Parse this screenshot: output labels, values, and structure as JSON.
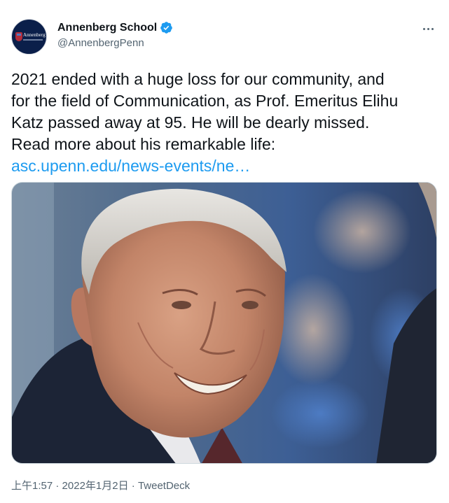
{
  "author": {
    "display_name": "Annenberg School",
    "handle": "@AnnenbergPenn",
    "avatar_text": "Annenberg",
    "verified_icon": "verified-badge-icon",
    "verified_color": "#1d9bf0"
  },
  "menu": {
    "icon": "more-horizontal-icon"
  },
  "tweet": {
    "lines": [
      "2021 ended with a huge loss for our community, and",
      "for the field of Communication, as Prof. Emeritus Elihu",
      "Katz passed away at 95. He will be dearly missed.",
      "Read more about his remarkable life:"
    ],
    "link_text": "asc.upenn.edu/news-events/ne…",
    "link_color": "#1d9bf0"
  },
  "media": {
    "subject": "photo-elderly-man-smiling"
  },
  "meta": {
    "time": "上午1:57",
    "separator": " · ",
    "date": "2022年1月2日",
    "source": "TweetDeck"
  }
}
